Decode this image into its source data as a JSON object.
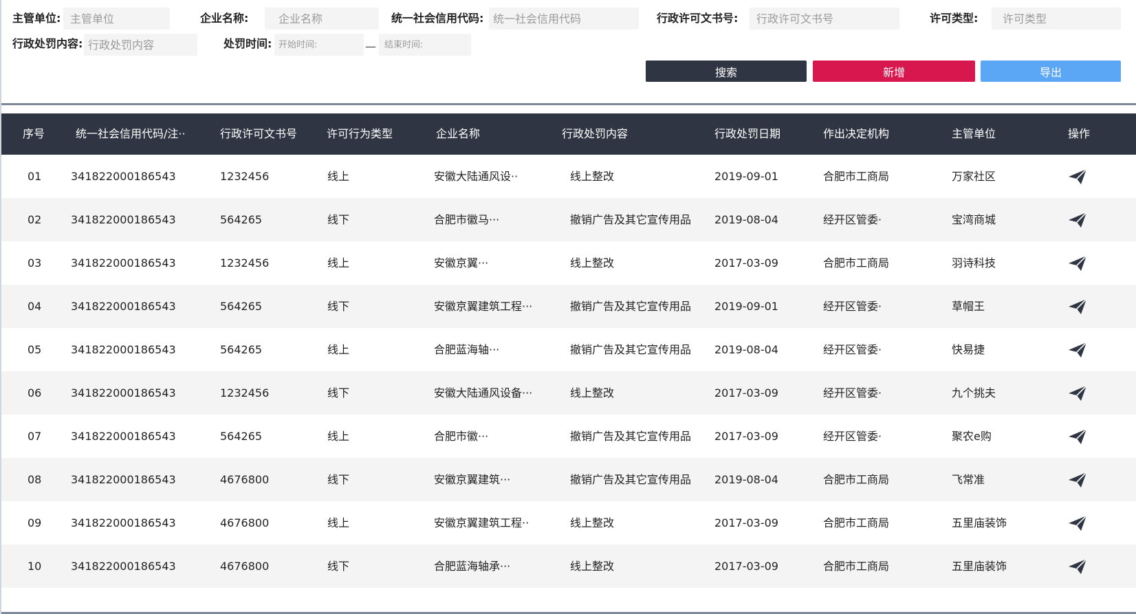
{
  "filters": {
    "dept_label": "主管单位:",
    "dept_placeholder": "主管单位",
    "company_label": "企业名称:",
    "company_placeholder": "企业名称",
    "credit_label": "统一社会信用代码:",
    "credit_placeholder": "统一社会信用代码",
    "permit_label": "行政许可文书号:",
    "permit_placeholder": "行政许可文书号",
    "type_label": "许可类型:",
    "type_placeholder": "许可类型",
    "content_label": "行政处罚内容:",
    "content_placeholder": "行政处罚内容",
    "time_label": "处罚时间:",
    "start_placeholder": "开始时间:",
    "range_separator": "—",
    "end_placeholder": "结束时间:"
  },
  "actions": {
    "search_label": "搜索",
    "add_label": "新增",
    "export_label": "导出"
  },
  "table": {
    "headers": [
      "序号",
      "统一社会信用代码/注··",
      "行政许可文书号",
      "许可行为类型",
      "企业名称",
      "行政处罚内容",
      "行政处罚日期",
      "作出决定机构",
      "主管单位",
      "操作"
    ],
    "action_icon": "paper-plane-icon",
    "rows": [
      [
        "01",
        "341822000186543",
        "1232456",
        "线上",
        "安徽大陆通风设··",
        "线上整改",
        "2019-09-01",
        "合肥市工商局",
        "万家社区"
      ],
      [
        "02",
        "341822000186543",
        "564265",
        "线下",
        "合肥市徽马···",
        "撤销广告及其它宣传用品",
        "2019-08-04",
        "经开区管委·",
        "宝湾商城"
      ],
      [
        "03",
        "341822000186543",
        "1232456",
        "线上",
        "安徽京翼···",
        "线上整改",
        "2017-03-09",
        "合肥市工商局",
        "羽诗科技"
      ],
      [
        "04",
        "341822000186543",
        "564265",
        "线下",
        "安徽京翼建筑工程···",
        "撤销广告及其它宣传用品",
        "2019-09-01",
        "经开区管委·",
        "草帽王"
      ],
      [
        "05",
        "341822000186543",
        "564265",
        "线上",
        "合肥蓝海轴···",
        "撤销广告及其它宣传用品",
        "2019-08-04",
        "经开区管委·",
        "快易捷"
      ],
      [
        "06",
        "341822000186543",
        "1232456",
        "线下",
        "安徽大陆通风设备···",
        "线上整改",
        "2017-03-09",
        "经开区管委·",
        "九个挑夫"
      ],
      [
        "07",
        "341822000186543",
        "564265",
        "线上",
        "合肥市徽···",
        "撤销广告及其它宣传用品",
        "2017-03-09",
        "经开区管委·",
        "聚农e购"
      ],
      [
        "08",
        "341822000186543",
        "4676800",
        "线下",
        "安徽京翼建筑···",
        "撤销广告及其它宣传用品",
        "2019-08-04",
        "合肥市工商局",
        "飞常准"
      ],
      [
        "09",
        "341822000186543",
        "4676800",
        "线上",
        "安徽京翼建筑工程··",
        "线上整改",
        "2017-03-09",
        "合肥市工商局",
        "五里庙装饰"
      ],
      [
        "10",
        "341822000186543",
        "4676800",
        "线下",
        "合肥蓝海轴承···",
        "线上整改",
        "2017-03-09",
        "合肥市工商局",
        "五里庙装饰"
      ]
    ]
  },
  "colors": {
    "header_bg": "#2f3542",
    "search_btn": "#2f3542",
    "add_btn": "#d8174f",
    "export_btn": "#5ba6f5",
    "row_alt_bg": "#f4f4f4",
    "icon_color": "#2f3542"
  }
}
